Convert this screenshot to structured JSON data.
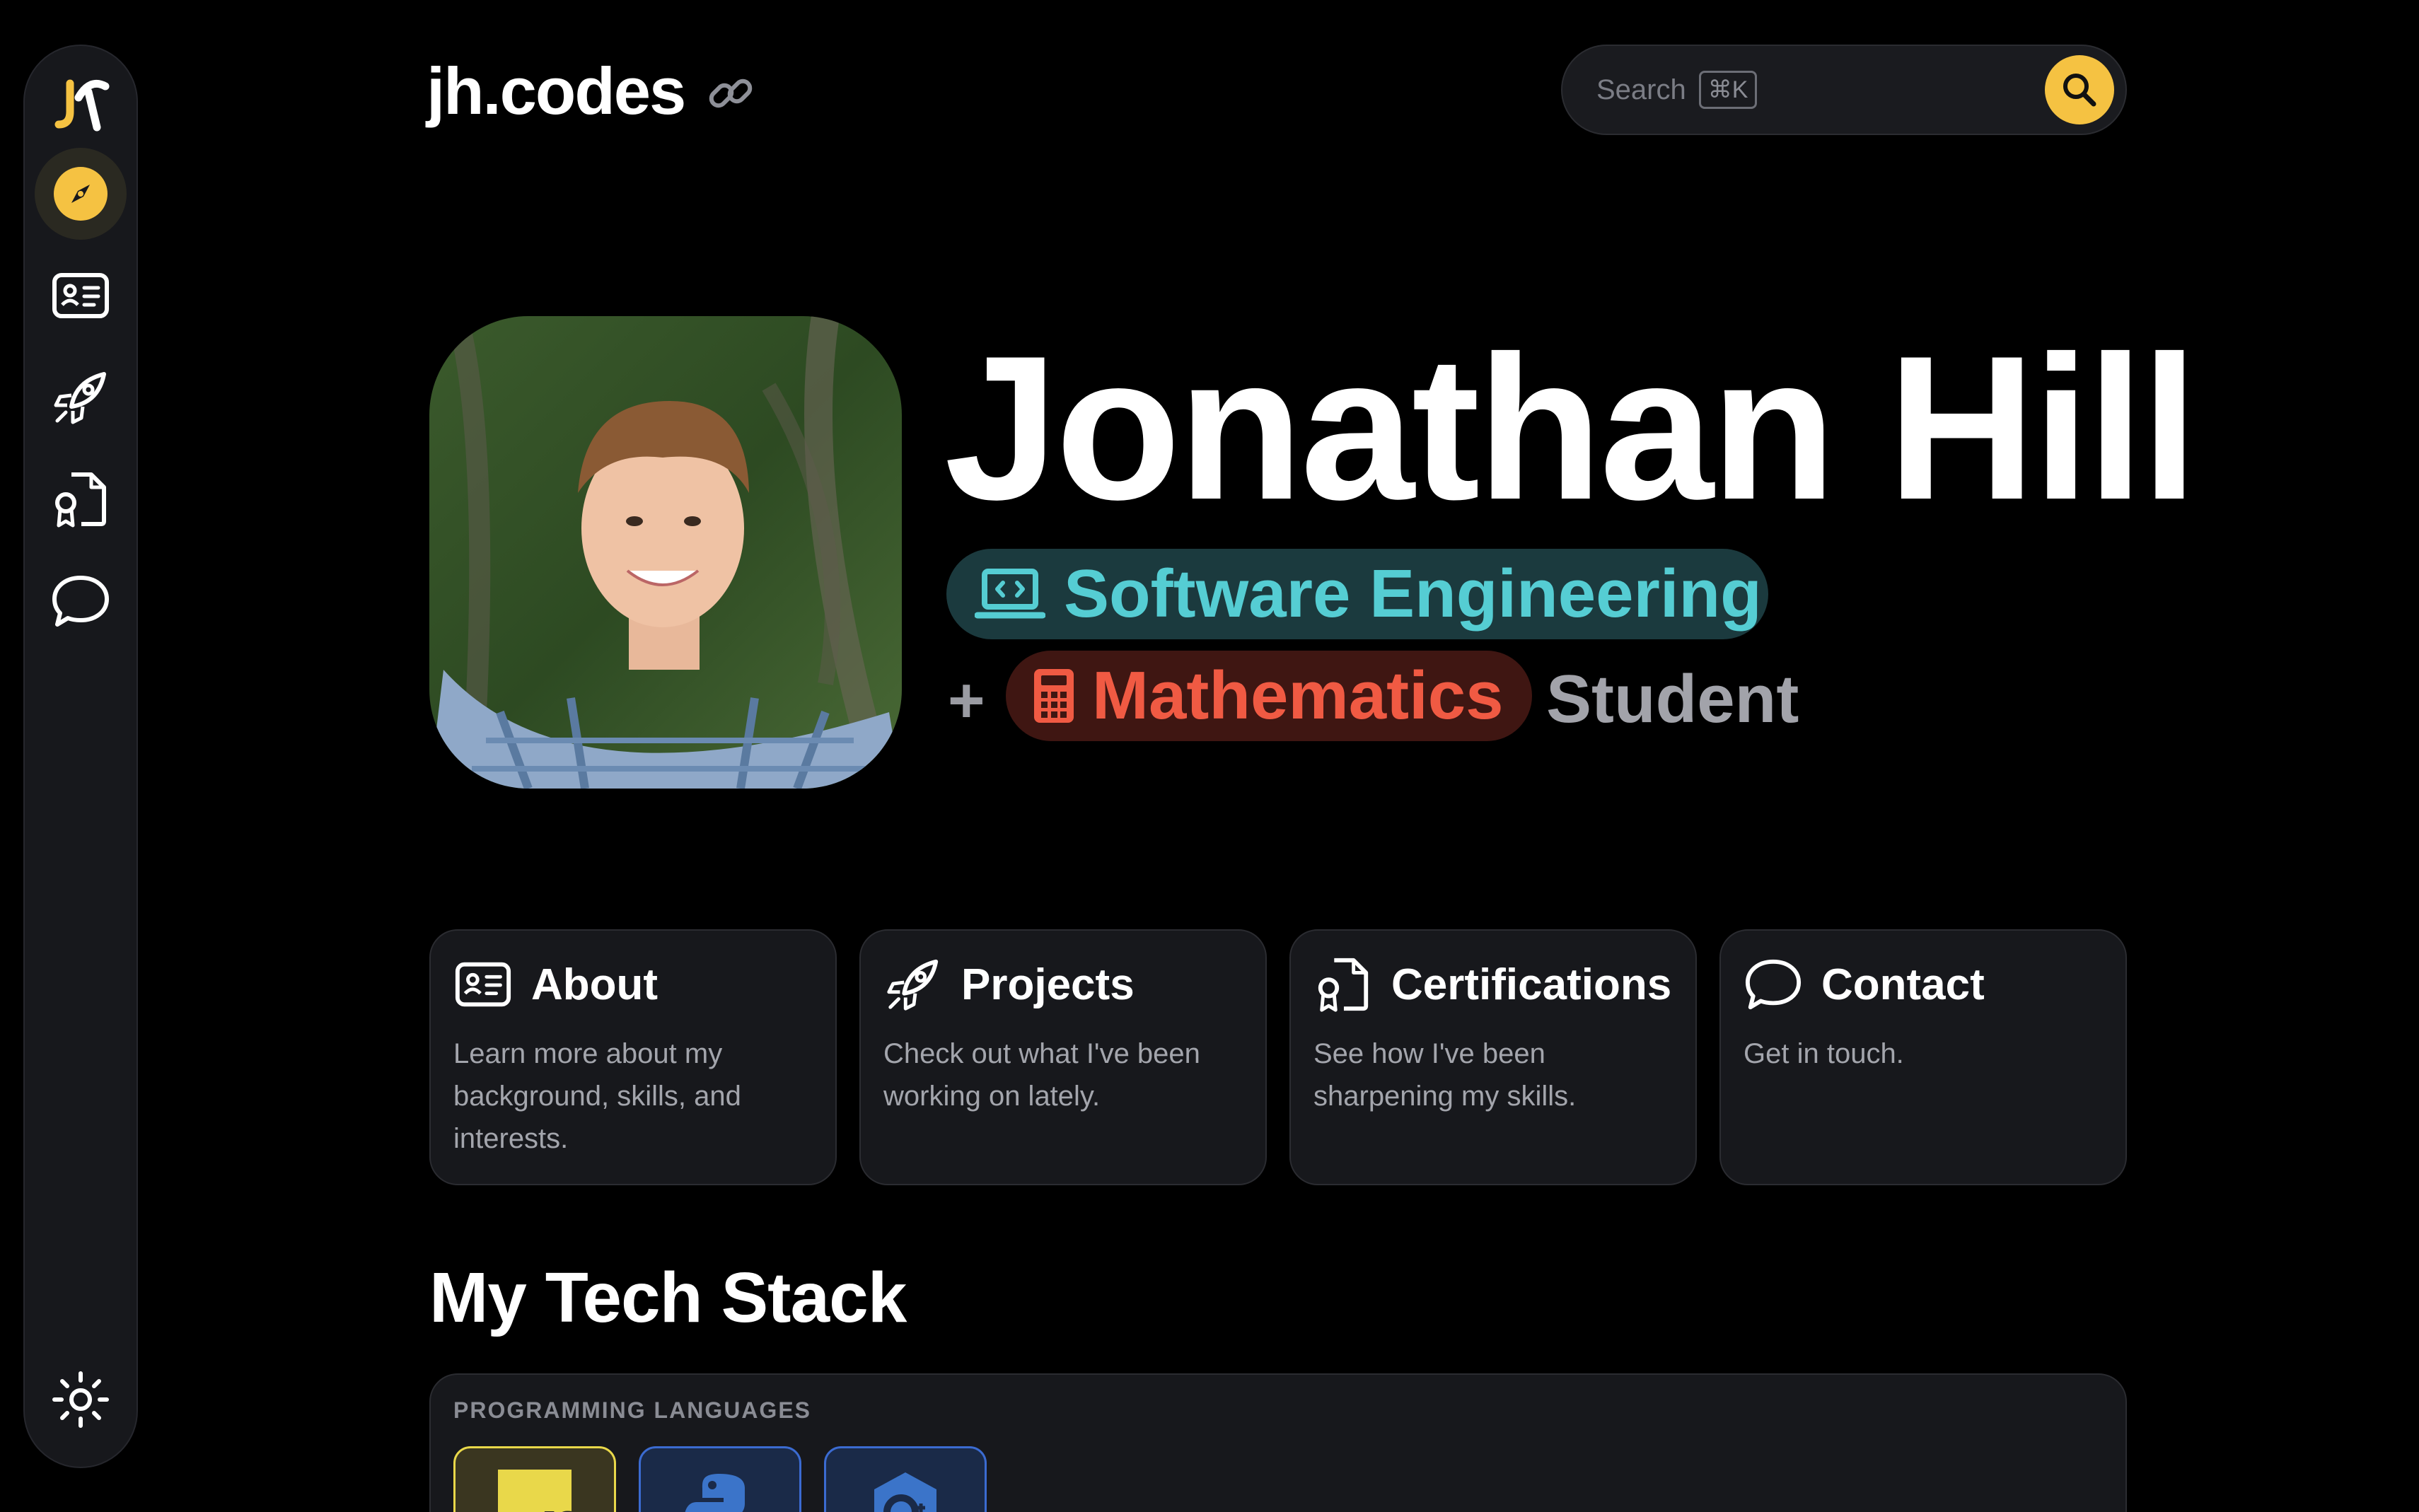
{
  "header": {
    "brand": "jh.codes",
    "search_placeholder": "Search",
    "search_shortcut": "⌘K"
  },
  "sidebar": {
    "items": [
      {
        "name": "explore",
        "icon": "compass-icon",
        "active": true
      },
      {
        "name": "about",
        "icon": "id-card-icon"
      },
      {
        "name": "projects",
        "icon": "rocket-icon"
      },
      {
        "name": "certifications",
        "icon": "certificate-icon"
      },
      {
        "name": "contact",
        "icon": "chat-bubble-icon"
      }
    ],
    "theme_icon": "sun-icon"
  },
  "hero": {
    "name": "Jonathan Hill",
    "tag_software": "Software Engineering",
    "plus": "+",
    "tag_math": "Mathematics",
    "suffix": "Student"
  },
  "cards": [
    {
      "title": "About",
      "desc": "Learn more about my background, skills, and interests.",
      "icon": "id-card-icon"
    },
    {
      "title": "Projects",
      "desc": "Check out what I've been working on lately.",
      "icon": "rocket-icon"
    },
    {
      "title": "Certifications",
      "desc": "See how I've been sharpening my skills.",
      "icon": "certificate-icon"
    },
    {
      "title": "Contact",
      "desc": "Get in touch.",
      "icon": "chat-bubble-icon"
    }
  ],
  "tech_stack": {
    "title": "My Tech Stack",
    "category": "PROGRAMMING LANGUAGES",
    "items": [
      {
        "name": "JavaScript",
        "label": "JS"
      },
      {
        "name": "Python"
      },
      {
        "name": "C++"
      }
    ]
  },
  "colors": {
    "accent": "#f5c242",
    "software_pill_bg": "#1b3a3e",
    "software_pill_text": "#55cdd3",
    "math_pill_bg": "#3f1612",
    "math_pill_text": "#f05a43"
  }
}
